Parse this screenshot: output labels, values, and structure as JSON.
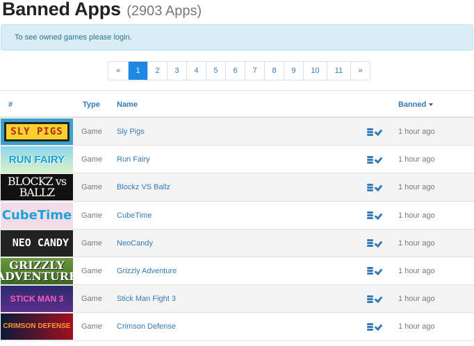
{
  "header": {
    "title": "Banned Apps",
    "count": "(2903 Apps)"
  },
  "alert": {
    "text": "To see owned games please login."
  },
  "pagination": {
    "items": [
      {
        "label": "«",
        "w": 28
      },
      {
        "label": "1",
        "w": 28,
        "active": true
      },
      {
        "label": "2",
        "w": 28
      },
      {
        "label": "3",
        "w": 28
      },
      {
        "label": "4",
        "w": 28
      },
      {
        "label": "5",
        "w": 28
      },
      {
        "label": "6",
        "w": 28
      },
      {
        "label": "7",
        "w": 28
      },
      {
        "label": "8",
        "w": 28
      },
      {
        "label": "9",
        "w": 28
      },
      {
        "label": "10",
        "w": 34
      },
      {
        "label": "11",
        "w": 34
      },
      {
        "label": "»",
        "w": 28
      }
    ]
  },
  "table": {
    "headers": {
      "num": "#",
      "type": "Type",
      "name": "Name",
      "banned": "Banned"
    },
    "sort": "desc",
    "rows": [
      {
        "thumb": "SLY PIGS",
        "thumb_style": "sly",
        "type": "Game",
        "name": "Sly Pigs",
        "banned": "1 hour ago"
      },
      {
        "thumb": "RUN FAIRY",
        "thumb_style": "run",
        "type": "Game",
        "name": "Run Fairy",
        "banned": "1 hour ago"
      },
      {
        "thumb": "BLOCKZ vs BALLZ",
        "thumb_style": "blockz",
        "type": "Game",
        "name": "Blockz VS Ballz",
        "banned": "1 hour ago"
      },
      {
        "thumb": "CubeTime",
        "thumb_style": "cube",
        "type": "Game",
        "name": "CubeTime",
        "banned": "1 hour ago"
      },
      {
        "thumb": "NEO CANDY",
        "thumb_style": "neo",
        "type": "Game",
        "name": "NeoCandy",
        "banned": "1 hour ago"
      },
      {
        "thumb": "GRIZZLY ADVENTURE",
        "thumb_style": "grizzly",
        "type": "Game",
        "name": "Grizzly Adventure",
        "banned": "1 hour ago"
      },
      {
        "thumb": "STICK MAN 3",
        "thumb_style": "stick",
        "type": "Game",
        "name": "Stick Man Fight 3",
        "banned": "1 hour ago"
      },
      {
        "thumb": "CRIMSON DEFENSE",
        "thumb_style": "crimson",
        "type": "Game",
        "name": "Crimson Defense",
        "banned": "1 hour ago"
      }
    ]
  }
}
